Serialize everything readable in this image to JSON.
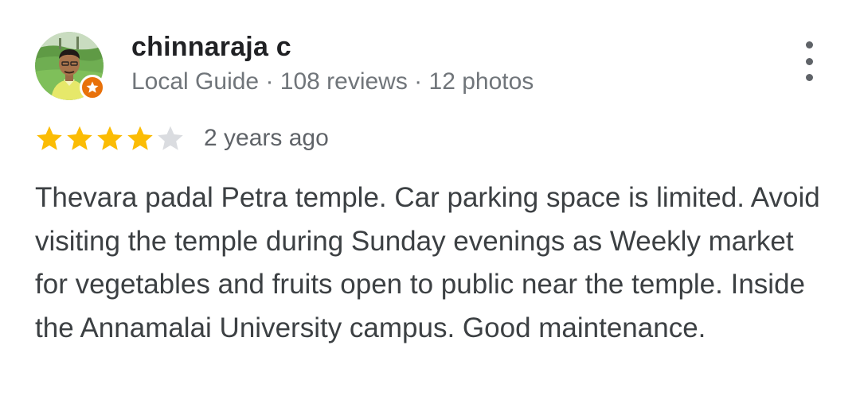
{
  "review": {
    "author": {
      "name": "chinnaraja c",
      "meta": "Local Guide · 108 reviews · 12 photos",
      "avatar_icon": "user-avatar",
      "badge_icon": "local-guide-star-icon"
    },
    "menu_icon": "more-vert-icon",
    "rating": {
      "stars": 4,
      "max": 5,
      "filled_color": "#fbbc04",
      "empty_color": "#dadce0"
    },
    "date": "2 years ago",
    "text": "Thevara padal Petra temple. Car parking space is limited. Avoid visiting the temple during Sunday evenings as Weekly market for vegetables and fruits open to public near the temple. Inside the Annamalai University campus. Good maintenance."
  }
}
